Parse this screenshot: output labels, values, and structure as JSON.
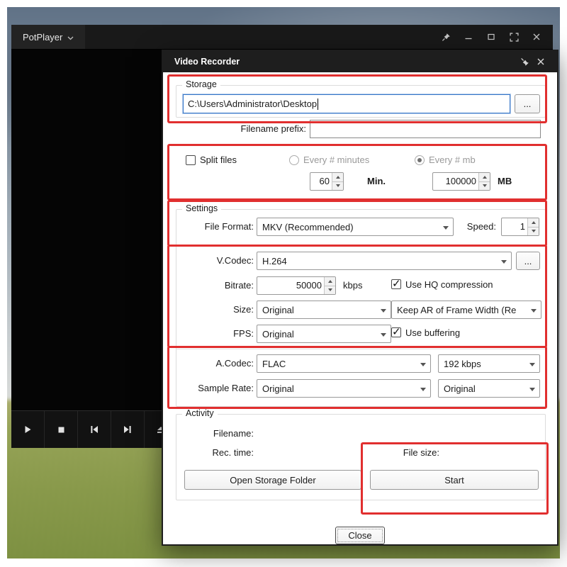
{
  "colors": {
    "annotation": "#e12f2f",
    "focus_border": "#3575c8"
  },
  "potplayer": {
    "title": "PotPlayer"
  },
  "dialog": {
    "title": "Video Recorder",
    "storage": {
      "legend": "Storage",
      "path": "C:\\Users\\Administrator\\Desktop",
      "browse": "..."
    },
    "prefix": {
      "label": "Filename prefix:",
      "value": ""
    },
    "split": {
      "label": "Split files",
      "every_minutes": "Every # minutes",
      "every_mb": "Every # mb",
      "minutes_value": "60",
      "minutes_unit": "Min.",
      "mb_value": "100000",
      "mb_unit": "MB"
    },
    "settings": {
      "legend": "Settings",
      "file_format": {
        "label": "File Format:",
        "value": "MKV (Recommended)"
      },
      "speed": {
        "label": "Speed:",
        "value": "1"
      },
      "vcodec": {
        "label": "V.Codec:",
        "value": "H.264",
        "more": "..."
      },
      "bitrate": {
        "label": "Bitrate:",
        "value": "50000",
        "unit": "kbps"
      },
      "hq": {
        "label": "Use HQ compression"
      },
      "size": {
        "label": "Size:",
        "value": "Original"
      },
      "aspect": {
        "value": "Keep AR of Frame Width (Re"
      },
      "fps": {
        "label": "FPS:",
        "value": "Original"
      },
      "buffering": {
        "label": "Use buffering"
      },
      "acodec": {
        "label": "A.Codec:",
        "value": "FLAC"
      },
      "audio_bitrate": {
        "value": "192 kbps"
      },
      "sample_rate": {
        "label": "Sample Rate:",
        "value": "Original"
      },
      "sample_rate2": {
        "value": "Original"
      }
    },
    "activity": {
      "legend": "Activity",
      "filename_label": "Filename:",
      "rec_time_label": "Rec. time:",
      "file_size_label": "File size:",
      "open_folder": "Open Storage Folder",
      "start": "Start"
    },
    "close": "Close"
  }
}
